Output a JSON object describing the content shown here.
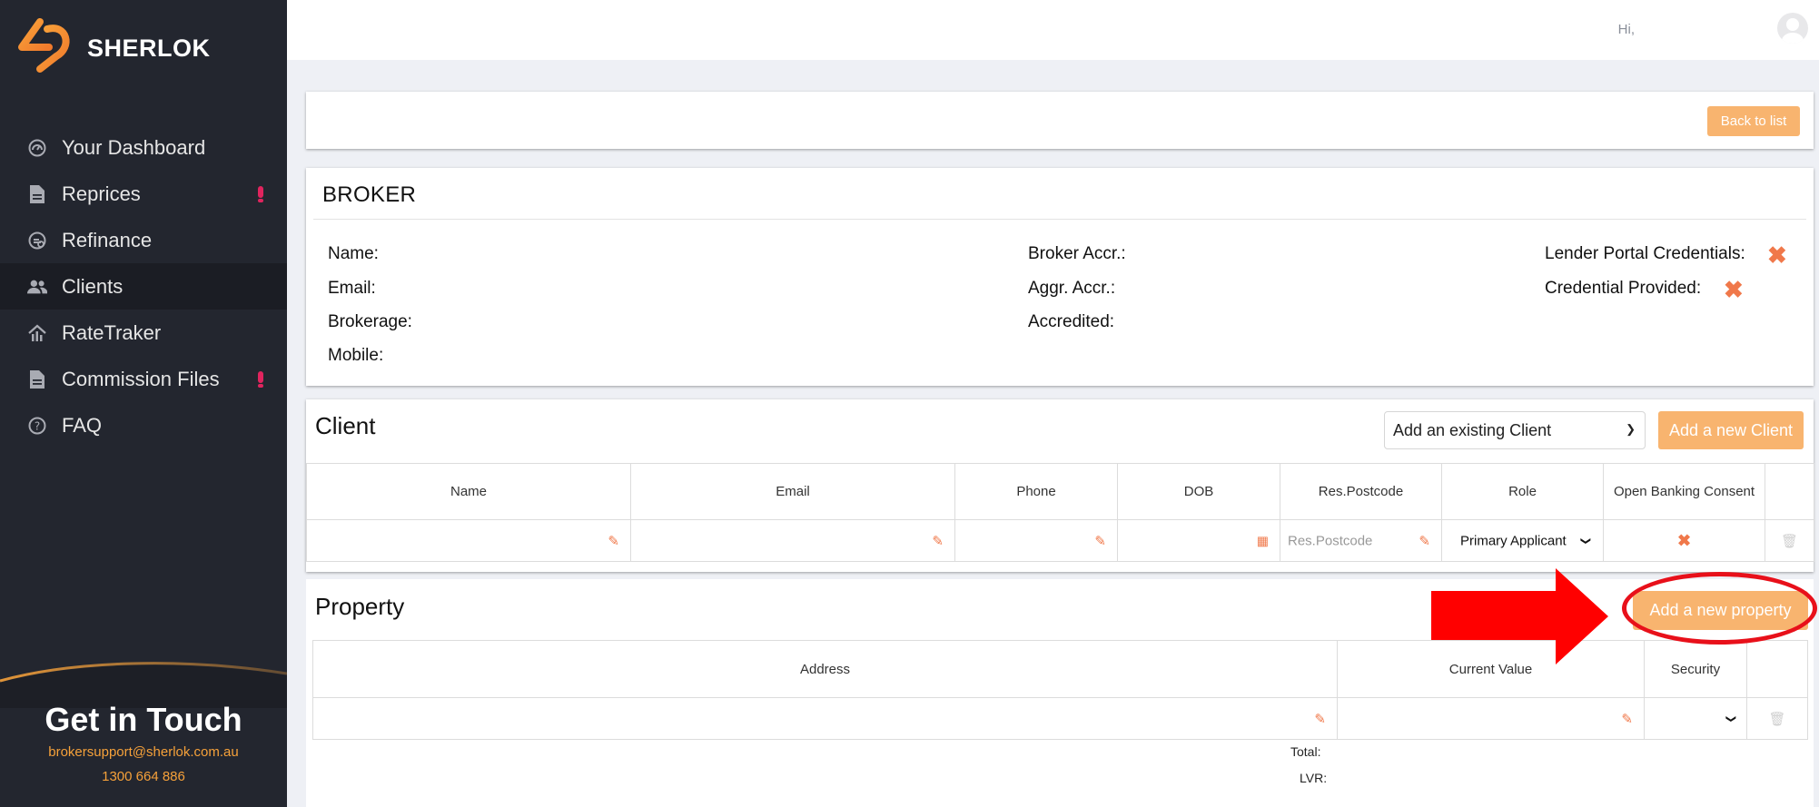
{
  "brand": {
    "name": "SHERLOK",
    "accent": "#f6a13a"
  },
  "sidebar": {
    "items": [
      {
        "label": "Your Dashboard",
        "icon": "dashboard-icon",
        "alert": false,
        "active": false
      },
      {
        "label": "Reprices",
        "icon": "document-icon",
        "alert": true,
        "active": false
      },
      {
        "label": "Refinance",
        "icon": "refinance-icon",
        "alert": false,
        "active": false
      },
      {
        "label": "Clients",
        "icon": "users-icon",
        "alert": false,
        "active": true
      },
      {
        "label": "RateTraker",
        "icon": "house-chart-icon",
        "alert": false,
        "active": false
      },
      {
        "label": "Commission Files",
        "icon": "document-icon",
        "alert": true,
        "active": false
      },
      {
        "label": "FAQ",
        "icon": "question-icon",
        "alert": false,
        "active": false
      }
    ],
    "contact": {
      "title": "Get in Touch",
      "email": "brokersupport@sherlok.com.au",
      "phone": "1300 664 886"
    }
  },
  "header": {
    "greeting": "Hi,"
  },
  "toolbar": {
    "back_label": "Back to list"
  },
  "broker": {
    "title": "BROKER",
    "name_label": "Name:",
    "email_label": "Email:",
    "brokerage_label": "Brokerage:",
    "mobile_label": "Mobile:",
    "broker_accr_label": "Broker Accr.:",
    "aggr_accr_label": "Aggr. Accr.:",
    "accredited_label": "Accredited:",
    "lender_portal_label": "Lender Portal Credentials:",
    "credential_provided_label": "Credential Provided:"
  },
  "client": {
    "title": "Client",
    "select_value": "Add an existing Client",
    "add_label": "Add a new Client",
    "columns": [
      "Name",
      "Email",
      "Phone",
      "DOB",
      "Res.Postcode",
      "Role",
      "Open Banking Consent"
    ],
    "row": {
      "postcode_placeholder": "Res.Postcode",
      "role": "Primary Applicant"
    }
  },
  "property": {
    "title": "Property",
    "add_label": "Add a new property",
    "columns": [
      "Address",
      "Current Value",
      "Security"
    ],
    "total_label": "Total:",
    "lvr_label": "LVR:"
  }
}
